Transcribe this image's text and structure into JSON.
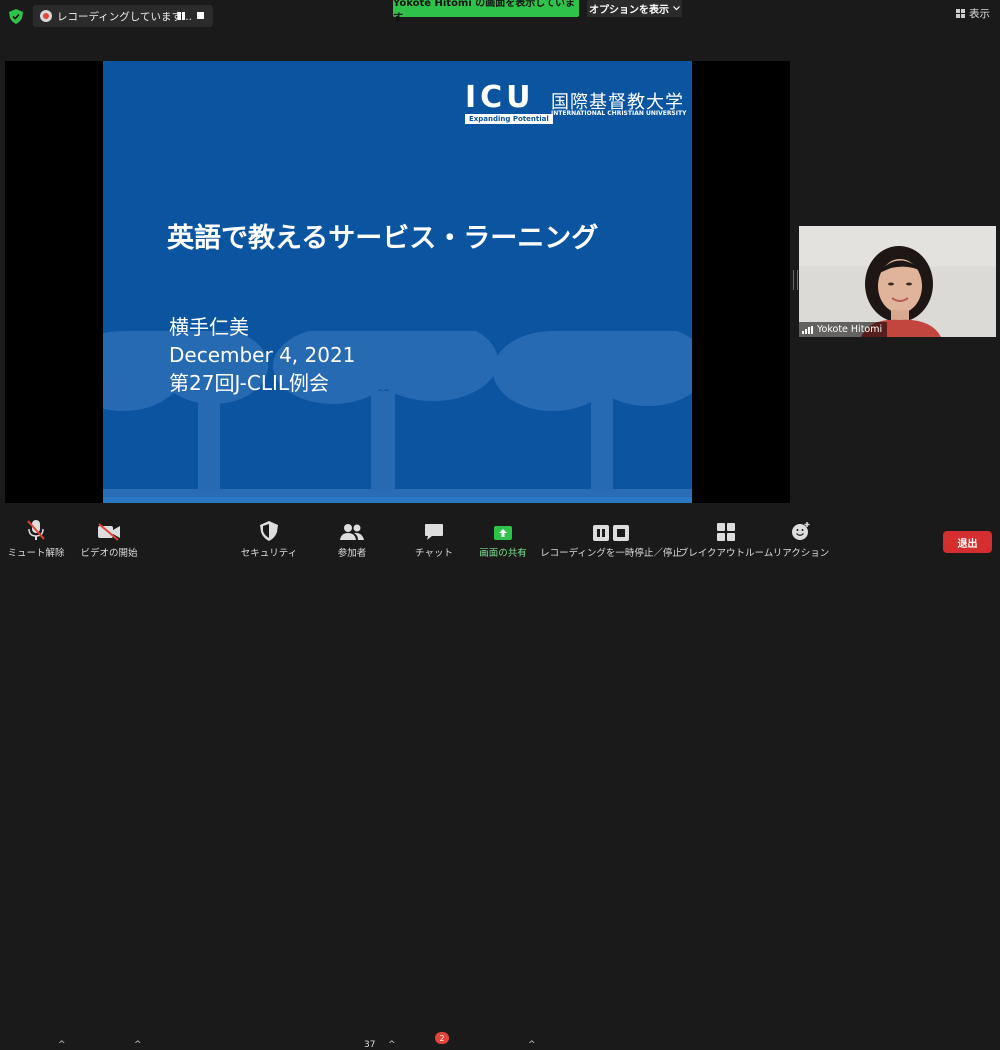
{
  "recording": {
    "status_text": "レコーディングしています...",
    "pause_icon": "pause-icon",
    "stop_icon": "stop-icon"
  },
  "share_banner": {
    "text": "Yokote Hitomi の画面を表示しています",
    "color": "#2fc24a"
  },
  "options": {
    "label": "オプションを表示"
  },
  "view": {
    "label": "表示"
  },
  "slide": {
    "logo_text": "ICU",
    "logo_tagline": "Expanding Potential",
    "university_jp": "国際基督教大学",
    "university_en": "INTERNATIONAL CHRISTIAN UNIVERSITY",
    "title": "英語で教えるサービス・ラーニング",
    "lines": [
      "横手仁美",
      "December 4, 2021",
      "第27回J-CLIL例会"
    ],
    "background": "#0b55a0"
  },
  "participant": {
    "name": "Yokote Hitomi"
  },
  "toolbar": {
    "unmute": "ミュート解除",
    "start_video": "ビデオの開始",
    "security": "セキュリティ",
    "participants": "参加者",
    "participants_count": "37",
    "chat": "チャット",
    "chat_badge": "2",
    "share_screen": "画面の共有",
    "recording_pause": "レコーディングを一時停止／停止",
    "breakout": "ブレイクアウトルーム",
    "reactions": "リアクション",
    "leave": "退出",
    "accent": "#2fc24a",
    "leave_color": "#d42e2e"
  }
}
